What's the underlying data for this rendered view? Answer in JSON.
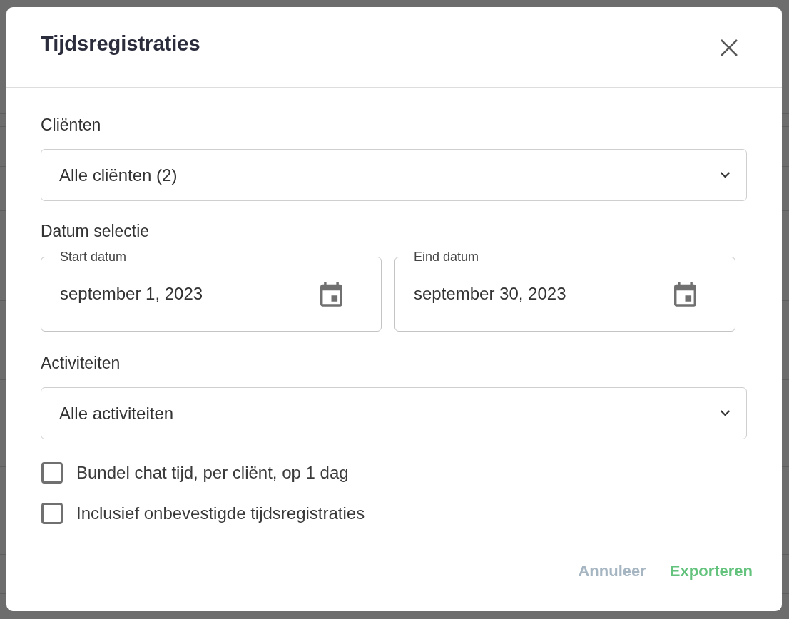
{
  "dialog": {
    "title": "Tijdsregistraties"
  },
  "fields": [
    {
      "kind": "select",
      "label": "Cliënten",
      "value": "Alle cliënten (2)"
    },
    {
      "kind": "date_range",
      "label": "Datum selectie",
      "dates": [
        {
          "label": "Start datum",
          "value": "september 1, 2023"
        },
        {
          "label": "Eind datum",
          "value": "september 30, 2023"
        }
      ]
    },
    {
      "kind": "select",
      "label": "Activiteiten",
      "value": "Alle activiteiten"
    }
  ],
  "options": [
    {
      "label": "Bundel chat tijd, per cliënt, op 1 dag",
      "checked": false
    },
    {
      "label": "Inclusief onbevestigde tijdsregistraties",
      "checked": false
    }
  ],
  "buttons": [
    {
      "kind": "cancel",
      "label": "Annuleer"
    },
    {
      "kind": "primary",
      "label": "Exporteren"
    }
  ]
}
